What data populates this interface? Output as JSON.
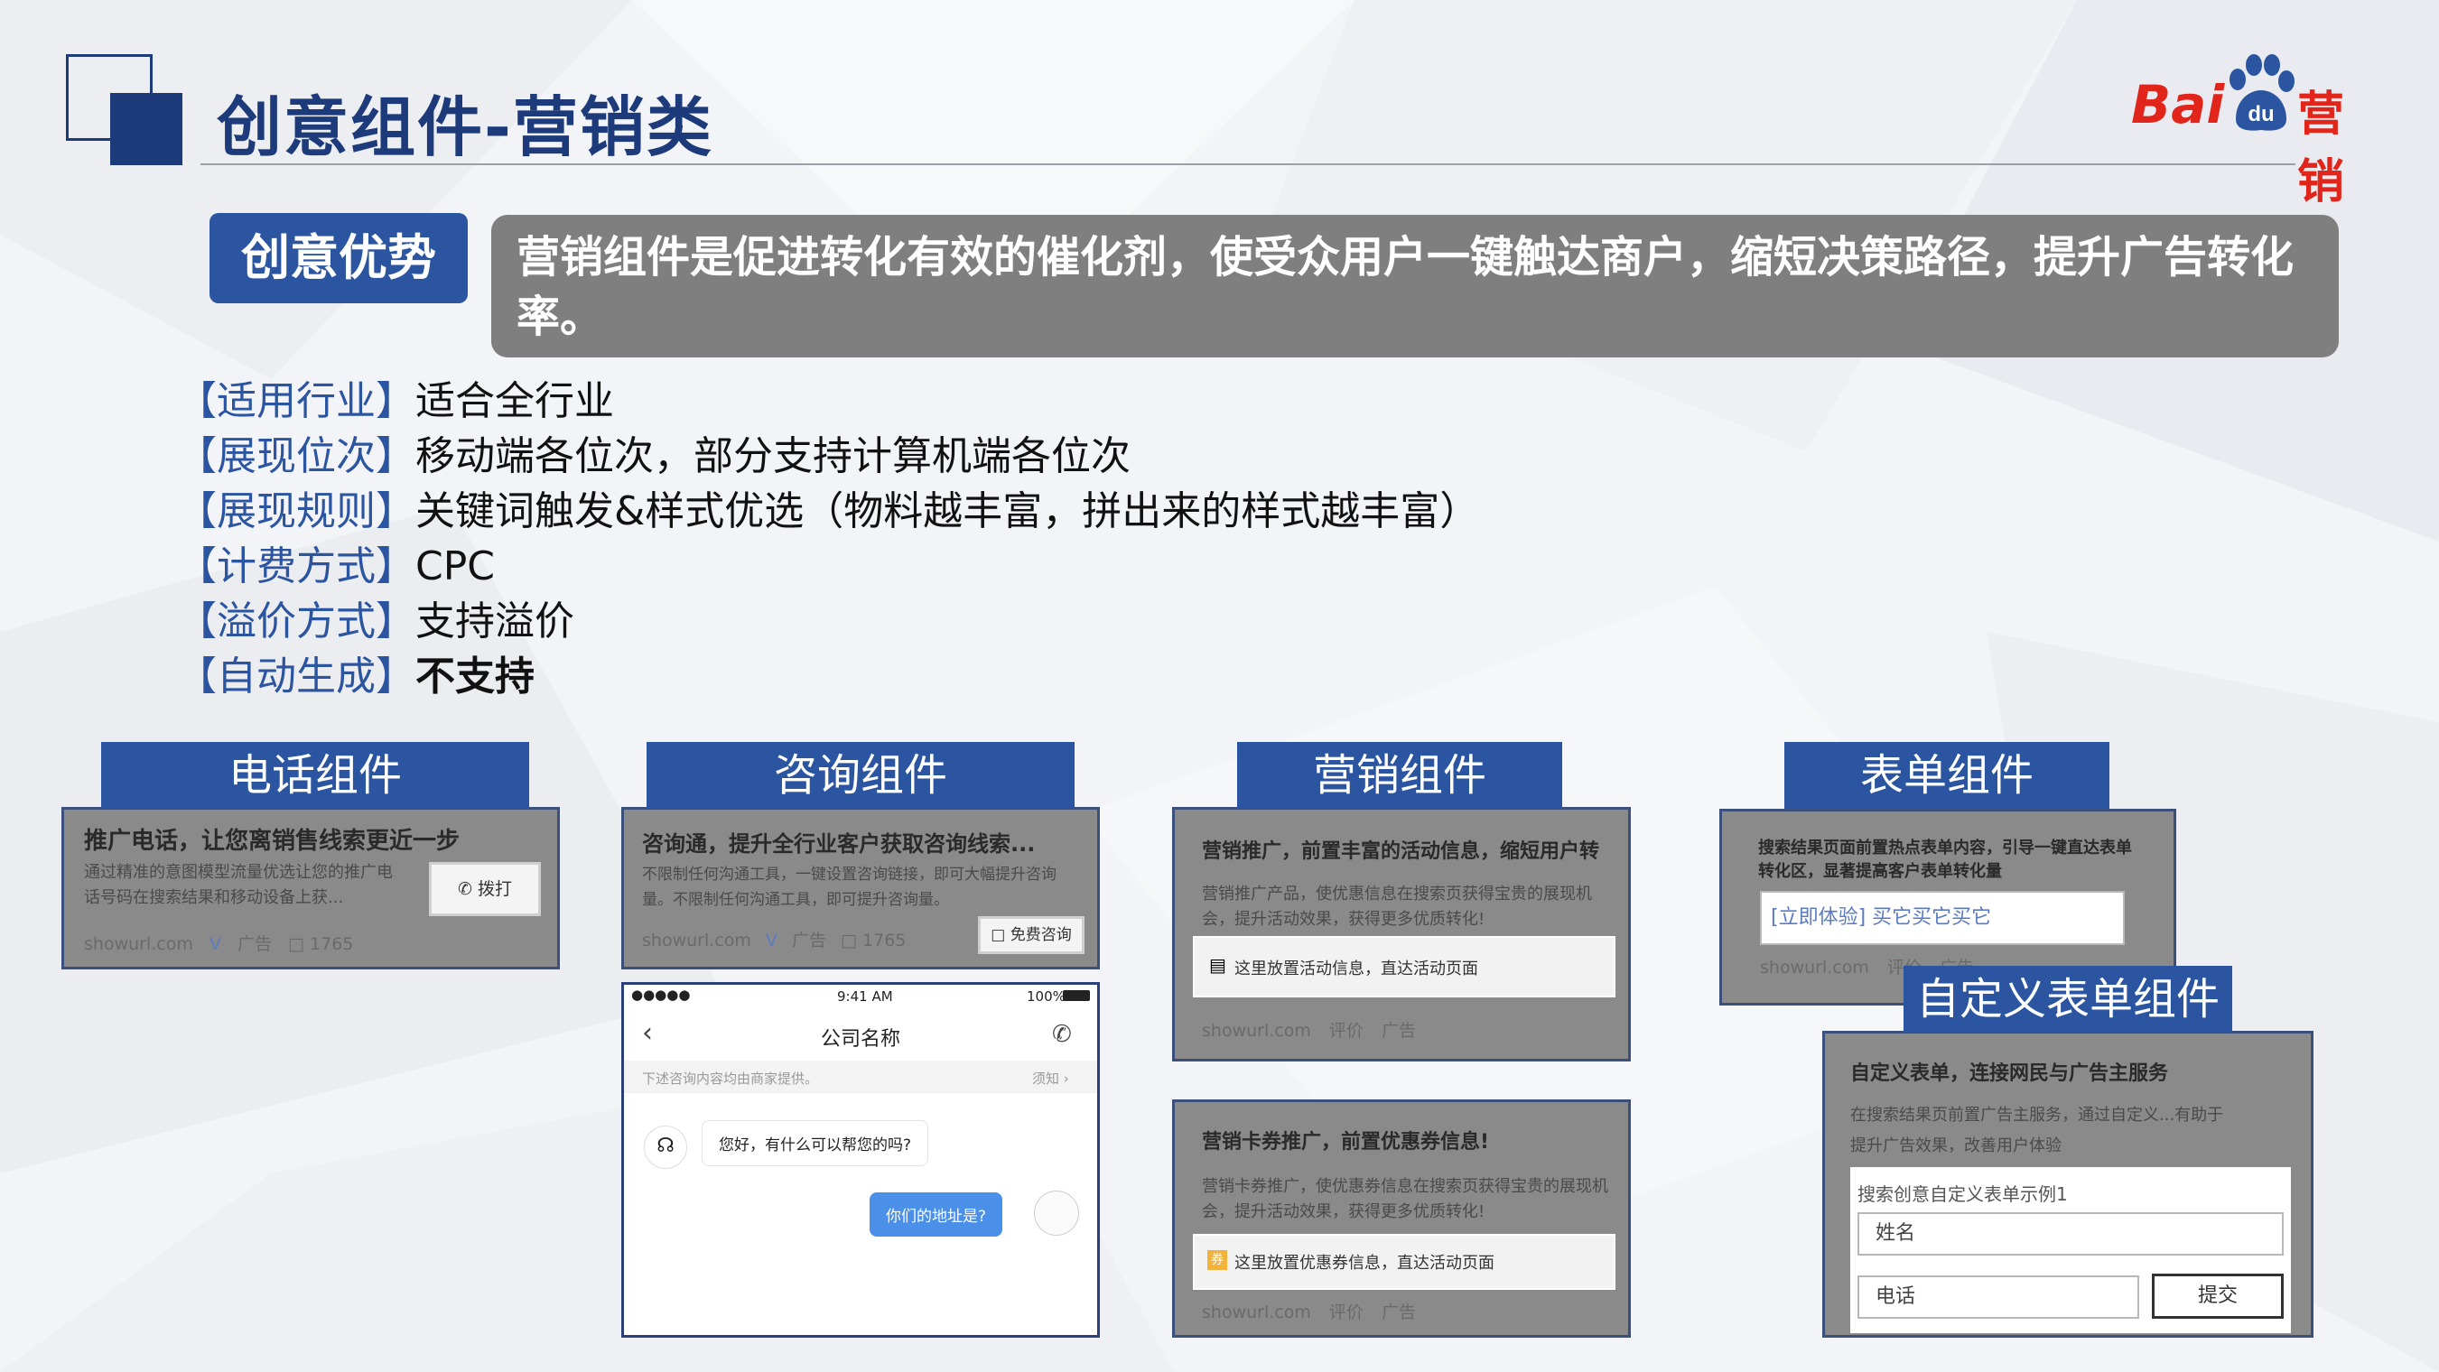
{
  "header": {
    "title": "创意组件-营销类",
    "brand": {
      "bai": "Bai",
      "du": "du",
      "marketing": "营销"
    },
    "colors": {
      "primary": "#1d3a7a",
      "accent": "#2b55a0",
      "brand_red": "#e1251b"
    }
  },
  "advantage": {
    "label": "创意优势",
    "text": "营销组件是促进转化有效的催化剂，使受众用户一键触达商户，缩短决策路径，提升广告转化率。"
  },
  "properties": [
    {
      "key": "【适用行业】",
      "value": "适合全行业"
    },
    {
      "key": "【展现位次】",
      "value": "移动端各位次，部分支持计算机端各位次"
    },
    {
      "key": "【展现规则】",
      "value": "关键词触发&样式优选（物料越丰富，拼出来的样式越丰富）"
    },
    {
      "key": "【计费方式】",
      "value": "CPC"
    },
    {
      "key": "【溢价方式】",
      "value": "支持溢价"
    },
    {
      "key": "【自动生成】",
      "value": "不支持"
    }
  ],
  "phone_card": {
    "tab": "电话组件",
    "title": "推广电话，让您离销售线索更近一步",
    "desc": "通过精准的意图模型流量优选让您的推广电话号码在搜索结果和移动设备上获...",
    "button": "拨打",
    "meta": {
      "url": "showurl.com",
      "v": "V",
      "ad": "广告",
      "count": "1765"
    }
  },
  "consult_card": {
    "tab": "咨询组件",
    "title": "咨询通，提升全行业客户获取咨询线索...",
    "desc": "不限制任何沟通工具，一键设置咨询链接，即可大幅提升咨询量。不限制任何沟通工具，即可提升咨询量。",
    "button": "免费咨询",
    "meta": {
      "url": "showurl.com",
      "v": "V",
      "ad": "广告",
      "count": "1765"
    }
  },
  "chat": {
    "status_time": "9:41 AM",
    "battery": "100%",
    "company": "公司名称",
    "notice": "下述咨询内容均由商家提供。",
    "notice_link": "须知",
    "agent_msg": "您好，有什么可以帮您的吗?",
    "user_msg": "你们的地址是?"
  },
  "marketing_card": {
    "tab": "营销组件",
    "title": "营销推广，前置丰富的活动信息，缩短用户转",
    "desc": "营销推广产品，使优惠信息在搜索页获得宝贵的展现机会，提升活动效果，获得更多优质转化!",
    "box": "这里放置活动信息，直达活动页面",
    "meta": {
      "url": "showurl.com",
      "review": "评价",
      "ad": "广告"
    }
  },
  "coupon_card": {
    "title": "营销卡券推广，前置优惠券信息!",
    "desc": "营销卡券推广，使优惠券信息在搜索页获得宝贵的展现机会，提升活动效果，获得更多优质转化!",
    "box": "这里放置优惠券信息，直达活动页面",
    "coupon_glyph": "券",
    "meta": {
      "url": "showurl.com",
      "review": "评价",
      "ad": "广告"
    }
  },
  "form_card": {
    "tab": "表单组件",
    "title": "搜索结果页面前置热点表单内容，引导一键直达表单转化区，显著提高客户表单转化量",
    "field": "[立即体验] 买它买它买它",
    "meta": {
      "url": "showurl.com",
      "review": "评价",
      "ad": "广告"
    }
  },
  "custom_form_card": {
    "tab": "自定义表单组件",
    "title": "自定义表单，连接网民与广告主服务",
    "desc": "在搜索结果页前置广告主服务，通过自定义...有助于提升广告效果，改善用户体验",
    "form_title": "搜索创意自定义表单示例1",
    "name_label": "姓名",
    "phone_label": "电话",
    "submit": "提交"
  }
}
